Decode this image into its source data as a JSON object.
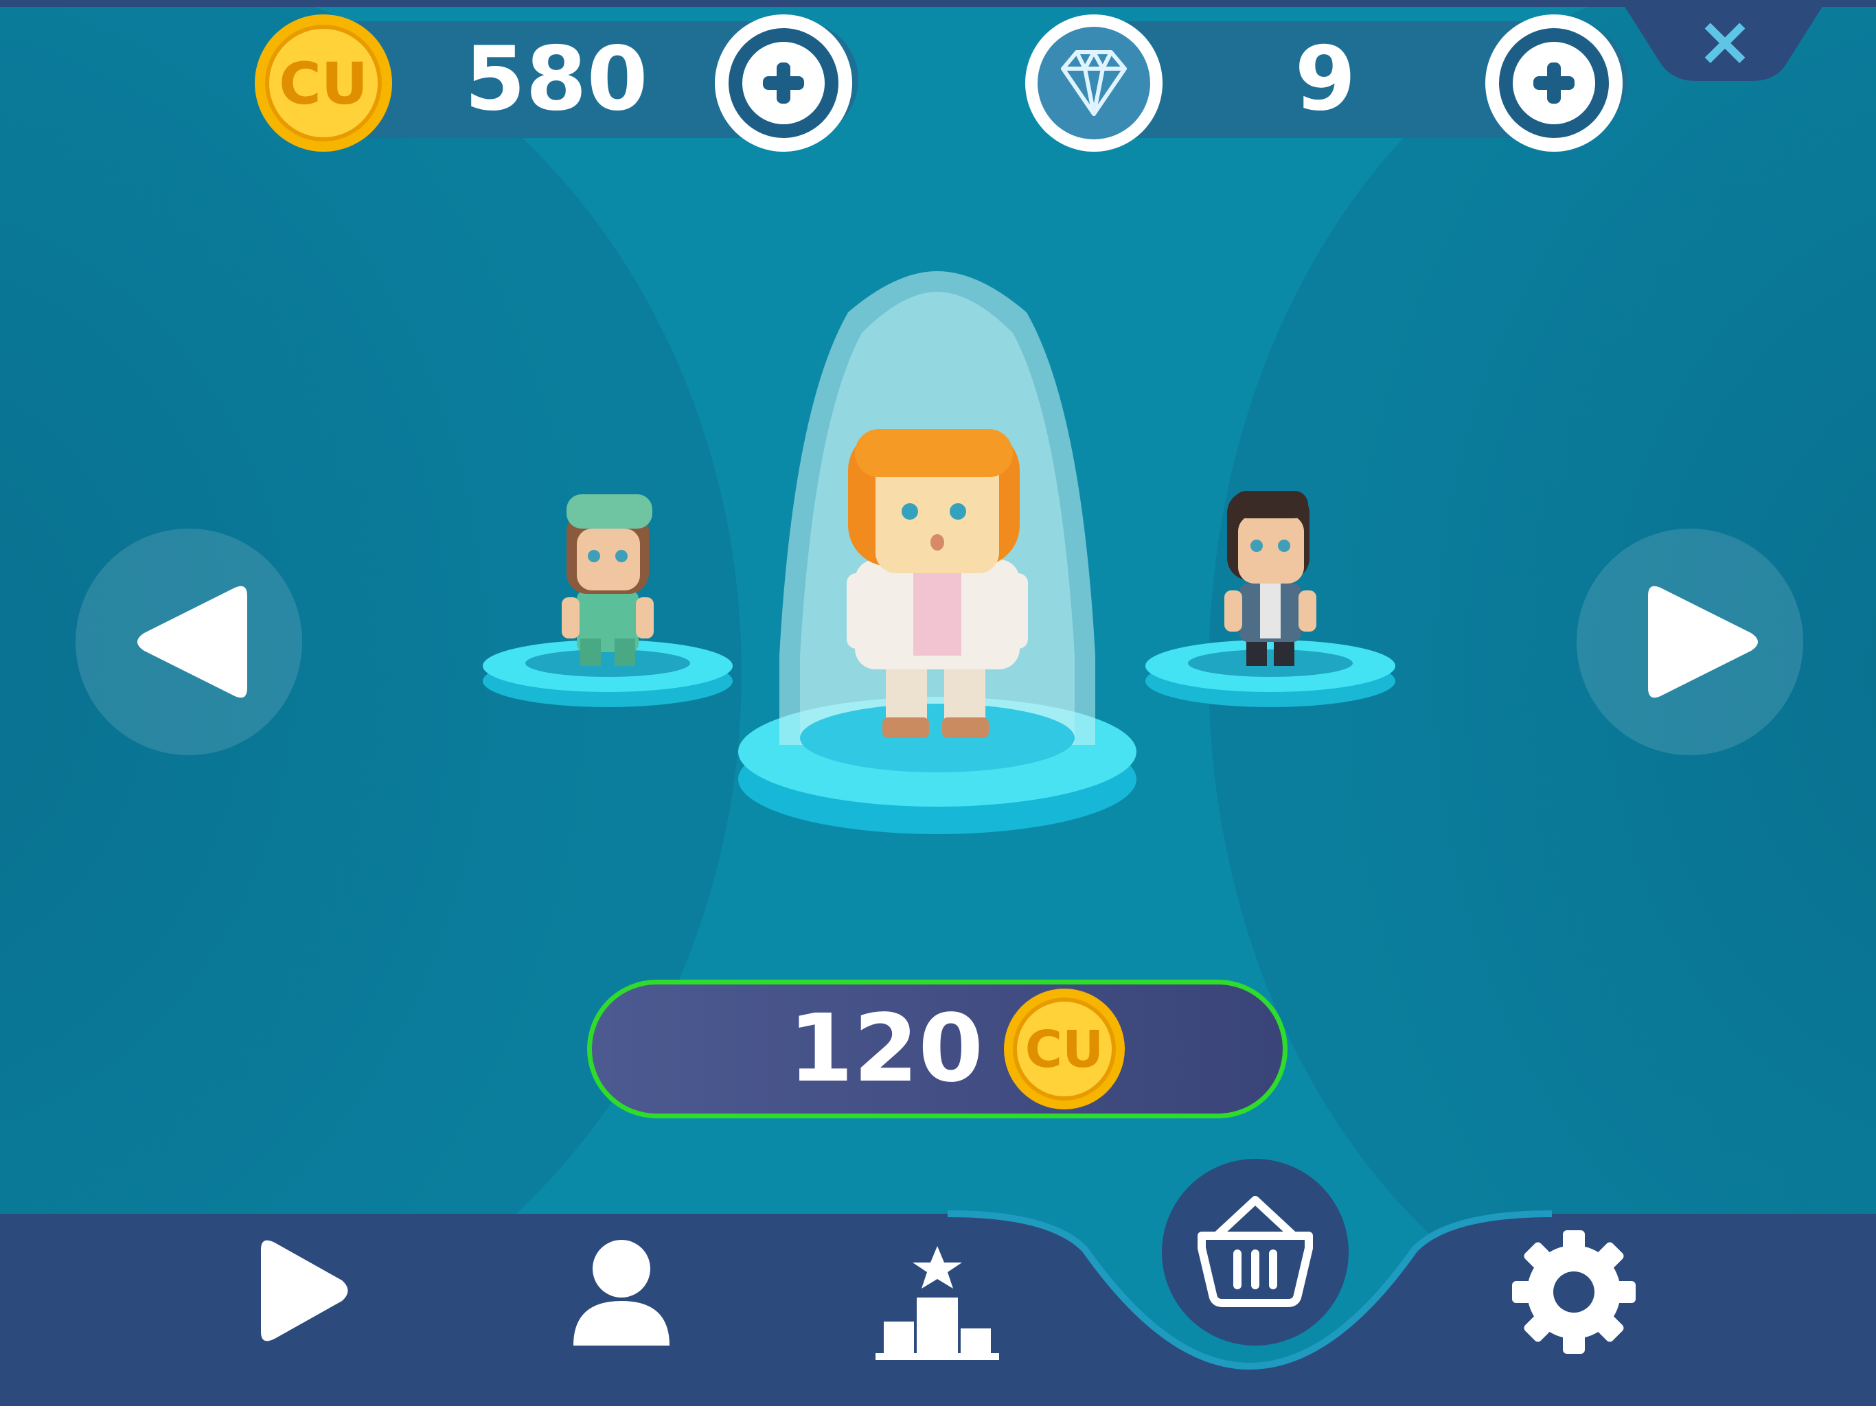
{
  "hud": {
    "coins": {
      "icon": "cu-coin-icon",
      "badge_text": "CU",
      "value": "580",
      "add_label": "+"
    },
    "gems": {
      "icon": "diamond-icon",
      "value": "9",
      "add_label": "+"
    },
    "close_label": "×"
  },
  "carousel": {
    "prev_icon": "triangle-left-icon",
    "next_icon": "triangle-right-icon",
    "characters": [
      {
        "position": "left",
        "description_icon": "nurse-character"
      },
      {
        "position": "center",
        "description_icon": "redhead-character",
        "selected": true
      },
      {
        "position": "right",
        "description_icon": "vest-character"
      }
    ]
  },
  "price": {
    "value": "120",
    "coin_badge": "CU"
  },
  "nav": {
    "tabs": [
      {
        "name": "play",
        "icon": "play-icon"
      },
      {
        "name": "profile",
        "icon": "person-icon"
      },
      {
        "name": "leaderboard",
        "icon": "podium-icon"
      },
      {
        "name": "shop",
        "icon": "basket-icon",
        "active": true
      },
      {
        "name": "settings",
        "icon": "gear-icon"
      }
    ]
  },
  "colors": {
    "background": "#0a85a3",
    "nav_bar": "#2c4a7c",
    "coin_gold": "#f4b400",
    "price_border": "#2fdc2c",
    "hud_bar": "#1f6f95"
  }
}
